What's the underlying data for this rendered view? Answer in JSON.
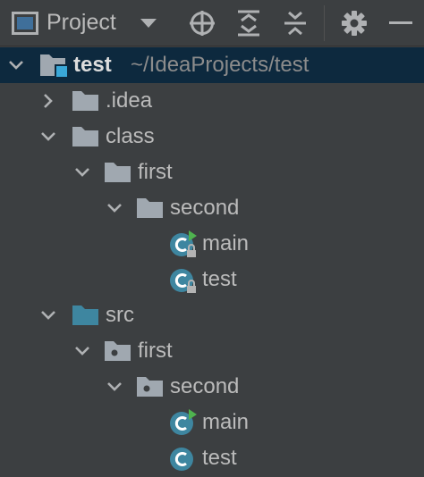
{
  "toolbar": {
    "title": "Project",
    "icons": [
      "project-view-icon",
      "dropdown-icon",
      "locate-icon",
      "expand-all-icon",
      "collapse-all-icon",
      "settings-icon",
      "hide-icon"
    ]
  },
  "tree": {
    "root": {
      "label": "test",
      "path": "~/IdeaProjects/test"
    },
    "idea": {
      "label": ".idea"
    },
    "class_dir": {
      "label": "class"
    },
    "class_first": {
      "label": "first"
    },
    "class_second": {
      "label": "second"
    },
    "class_main": {
      "label": "main"
    },
    "class_test": {
      "label": "test"
    },
    "src_dir": {
      "label": "src"
    },
    "src_first": {
      "label": "first"
    },
    "src_second": {
      "label": "second"
    },
    "src_main": {
      "label": "main"
    },
    "src_test": {
      "label": "test"
    }
  },
  "colors": {
    "background": "#3c3f41",
    "selection": "#0d293e",
    "folder": "#a0a8b0",
    "source_folder": "#3e86a0",
    "class_icon": "#3e86a0",
    "run_marker": "#4fb34f"
  }
}
